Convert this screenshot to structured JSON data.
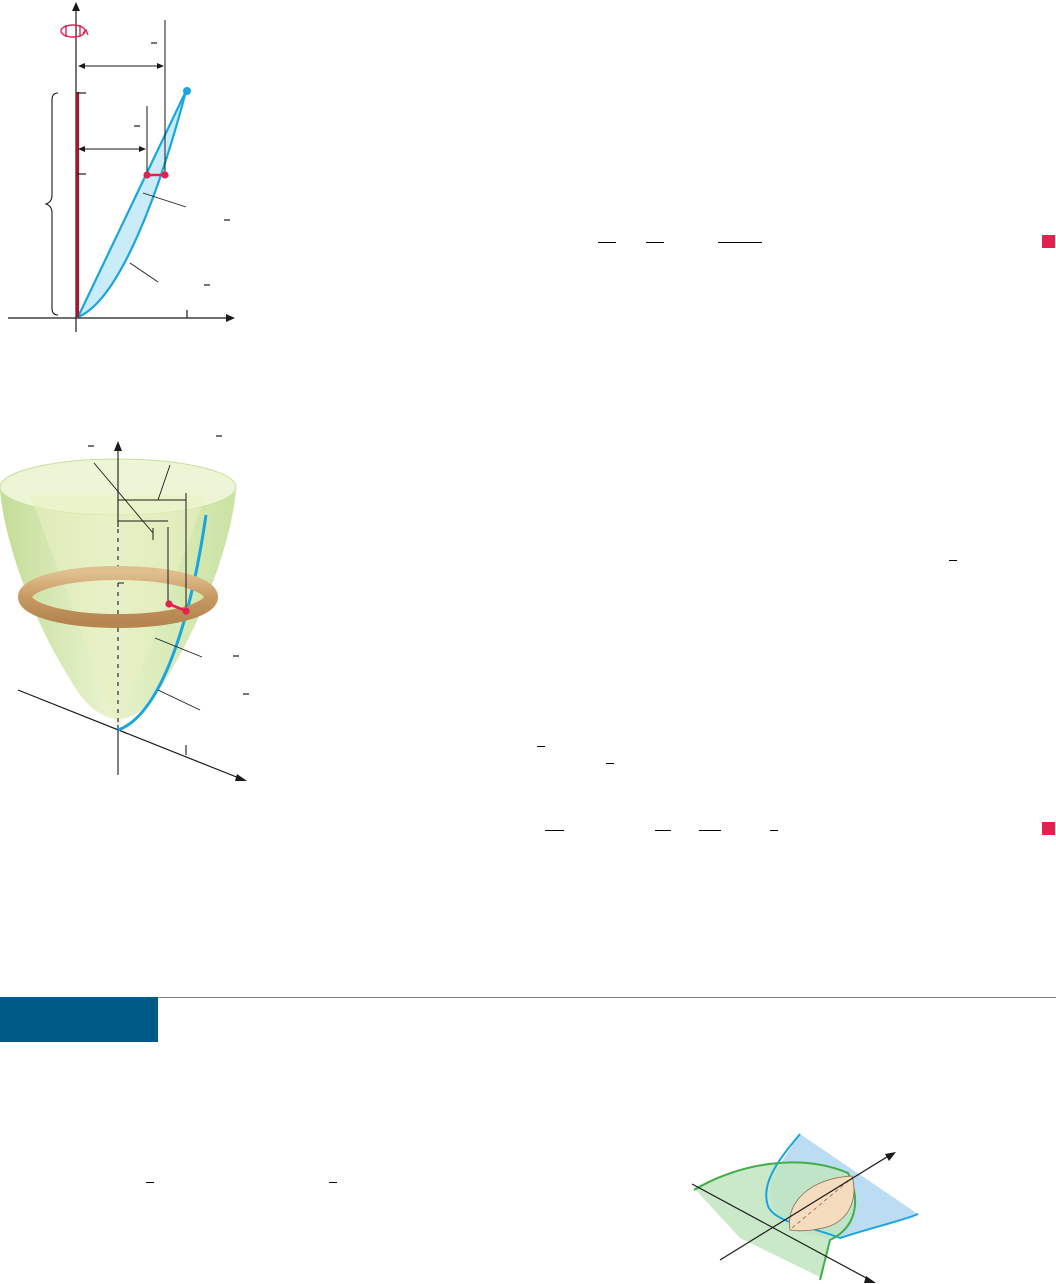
{
  "colors": {
    "accent_red": "#e2214f",
    "cyan_curve": "#19a6e0",
    "region_fill": "#c9ecf8",
    "axis_line": "#1a1a1a",
    "dark_red": "#a3182c",
    "section_tab": "#005a87",
    "rule": "#7f7f7f",
    "solid_green": "#cfe7a4",
    "ring_tan": "#c79a62",
    "plane_blue": "#bcdcf2",
    "plane_green": "#bfe5bf",
    "wedge_peach": "#f6dcbe"
  },
  "icons": {
    "rotation": "rotation-arrow-icon",
    "end_of_example": "end-of-example-square-icon"
  }
}
